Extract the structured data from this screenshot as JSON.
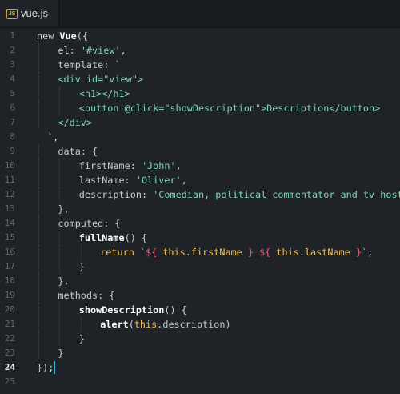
{
  "tab": {
    "icon": "js-file-icon",
    "icon_text": "JS",
    "filename": "vue.js"
  },
  "editor": {
    "active_line": 24,
    "lines": [
      [
        [
          "kw",
          "new "
        ],
        [
          "cls",
          "Vue"
        ],
        [
          "punc",
          "({"
        ]
      ],
      [
        [
          "prop",
          "el"
        ],
        [
          "punc",
          ": "
        ],
        [
          "str",
          "'#view'"
        ],
        [
          "punc",
          ","
        ]
      ],
      [
        [
          "prop",
          "template"
        ],
        [
          "punc",
          ": "
        ],
        [
          "str",
          "`"
        ]
      ],
      [
        [
          "tag",
          "<div id=\"view\">"
        ]
      ],
      [
        [
          "tag",
          "<h1></h1>"
        ]
      ],
      [
        [
          "tag",
          "<button @click=\"showDescription\">Description</button>"
        ]
      ],
      [
        [
          "tag",
          "</div>"
        ]
      ],
      [
        [
          "str",
          "`"
        ],
        [
          "punc",
          ","
        ]
      ],
      [
        [
          "prop",
          "data"
        ],
        [
          "punc",
          ": {"
        ]
      ],
      [
        [
          "prop",
          "firstName"
        ],
        [
          "punc",
          ": "
        ],
        [
          "str",
          "'John'"
        ],
        [
          "punc",
          ","
        ]
      ],
      [
        [
          "prop",
          "lastName"
        ],
        [
          "punc",
          ": "
        ],
        [
          "str",
          "'Oliver'"
        ],
        [
          "punc",
          ","
        ]
      ],
      [
        [
          "prop",
          "description"
        ],
        [
          "punc",
          ": "
        ],
        [
          "str",
          "'Comedian, political commentator and tv host.'"
        ]
      ],
      [
        [
          "punc",
          "},"
        ]
      ],
      [
        [
          "prop",
          "computed"
        ],
        [
          "punc",
          ": {"
        ]
      ],
      [
        [
          "fn",
          "fullName"
        ],
        [
          "punc",
          "() {"
        ]
      ],
      [
        [
          "ret",
          "return "
        ],
        [
          "str",
          "`"
        ],
        [
          "intp",
          "${ "
        ],
        [
          "this",
          "this"
        ],
        [
          "punc",
          "."
        ],
        [
          "mem",
          "firstName"
        ],
        [
          "intp",
          " } ${ "
        ],
        [
          "this",
          "this"
        ],
        [
          "punc",
          "."
        ],
        [
          "mem",
          "lastName"
        ],
        [
          "intp",
          " }"
        ],
        [
          "str",
          "`"
        ],
        [
          "punc",
          ";"
        ]
      ],
      [
        [
          "punc",
          "}"
        ]
      ],
      [
        [
          "punc",
          "},"
        ]
      ],
      [
        [
          "prop",
          "methods"
        ],
        [
          "punc",
          ": {"
        ]
      ],
      [
        [
          "fn",
          "showDescription"
        ],
        [
          "punc",
          "() {"
        ]
      ],
      [
        [
          "fn",
          "alert"
        ],
        [
          "punc",
          "("
        ],
        [
          "this",
          "this"
        ],
        [
          "punc",
          "."
        ],
        [
          "prop",
          "description"
        ],
        [
          "punc",
          ")"
        ]
      ],
      [
        [
          "punc",
          "}"
        ]
      ],
      [
        [
          "punc",
          "}"
        ]
      ],
      [
        [
          "punc",
          "});"
        ]
      ],
      []
    ]
  }
}
